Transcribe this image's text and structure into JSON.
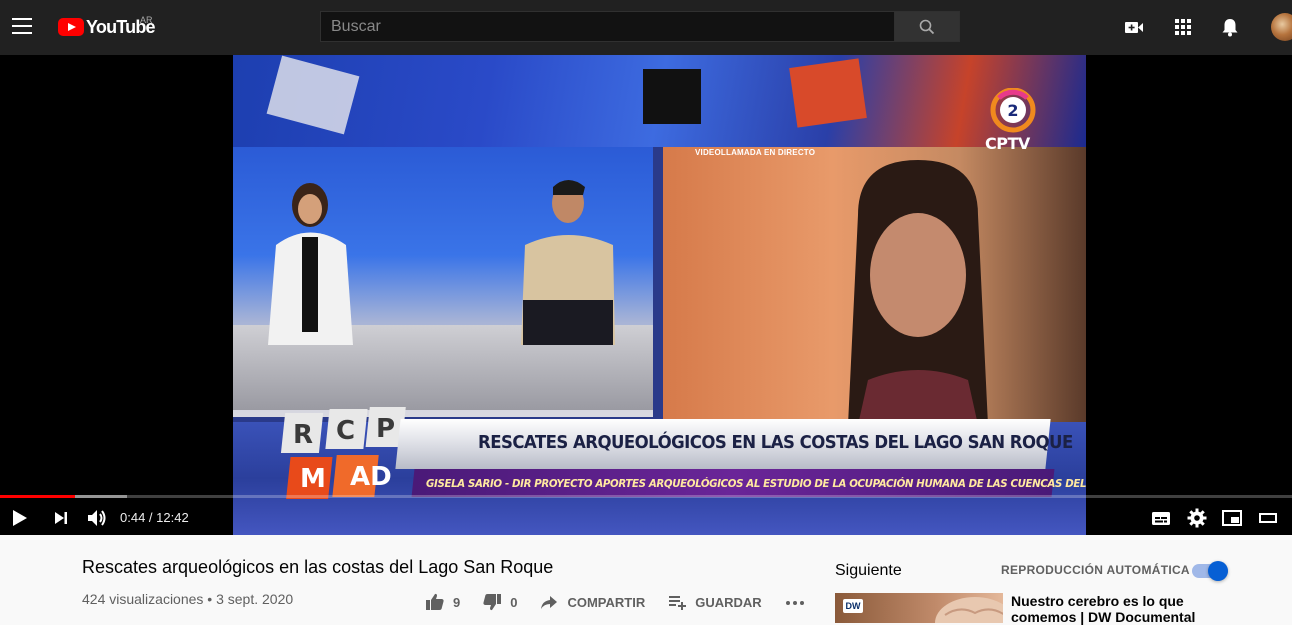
{
  "header": {
    "logo_text": "YouTube",
    "country_code": "AR",
    "search_placeholder": "Buscar"
  },
  "player": {
    "current_time": "0:44",
    "duration": "12:42",
    "time_display": "0:44 / 12:42",
    "progress_played": 0.0577,
    "progress_buffered": 0.098,
    "overlay": {
      "channel_logo_number": "2",
      "channel_logo_text": "CPTV",
      "call_label": "VIDEOLLAMADA EN DIRECTO",
      "show_badge_letters": "RCPMAD",
      "headline": "RESCATES ARQUEOLÓGICOS EN LAS COSTAS DEL LAGO SAN ROQUE",
      "subheadline": "GISELA SARIO - DIR PROYECTO APORTES ARQUEOLÓGICOS AL ESTUDIO DE LA OCUPACIÓN HUMANA DE LAS CUENCAS DEL RÍO SAN ANTONIO"
    }
  },
  "video_info": {
    "title": "Rescates arqueológicos en las costas del Lago San Roque",
    "meta": "424 visualizaciones • 3 sept. 2020",
    "likes": "9",
    "dislikes": "0",
    "share_label": "COMPARTIR",
    "save_label": "GUARDAR"
  },
  "sidebar": {
    "next_label": "Siguiente",
    "autoplay_label": "REPRODUCCIÓN AUTOMÁTICA",
    "autoplay_on": true,
    "recommendations": [
      {
        "title": "Nuestro cerebro es lo que comemos | DW Documental",
        "channel_badge": "DW"
      }
    ]
  },
  "colors": {
    "topbar": "#212121",
    "accent_red": "#ff0000",
    "toggle_blue": "#065fd4"
  }
}
